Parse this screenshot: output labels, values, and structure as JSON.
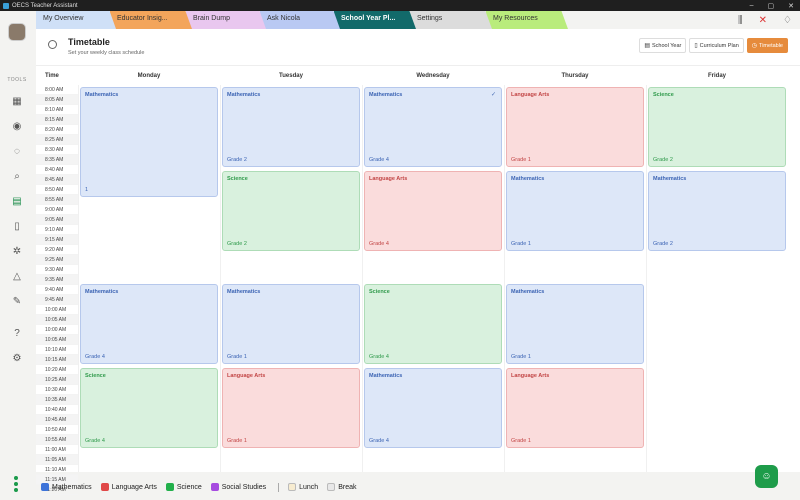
{
  "window": {
    "title": "OECS Teacher Assistant"
  },
  "tabs": [
    {
      "label": "My Overview",
      "color": "#cfe0f7"
    },
    {
      "label": "Educator Insig...",
      "color": "#f3a55b"
    },
    {
      "label": "Brain Dump",
      "color": "#e9c7ef"
    },
    {
      "label": "Ask Nicola",
      "color": "#b9c9f3"
    },
    {
      "label": "School Year Pl...",
      "color": "#126a6a",
      "active": true
    },
    {
      "label": "Settings",
      "color": "#dcdcdc"
    },
    {
      "label": "My Resources",
      "color": "#b9ec7c"
    }
  ],
  "sidebar": {
    "tools_label": "TOOLS"
  },
  "header": {
    "title": "Timetable",
    "subtitle": "Set your weekly class schedule",
    "views": [
      {
        "label": "School Year",
        "icon": "calendar-icon"
      },
      {
        "label": "Curriculum Plan",
        "icon": "book-icon"
      },
      {
        "label": "Timetable",
        "icon": "clock-icon",
        "active": true
      }
    ]
  },
  "grid": {
    "time_header": "Time",
    "days": [
      "Monday",
      "Tuesday",
      "Wednesday",
      "Thursday",
      "Friday"
    ],
    "times": [
      "8:00 AM",
      "8:05 AM",
      "8:10 AM",
      "8:15 AM",
      "8:20 AM",
      "8:25 AM",
      "8:30 AM",
      "8:35 AM",
      "8:40 AM",
      "8:45 AM",
      "8:50 AM",
      "8:55 AM",
      "9:00 AM",
      "9:05 AM",
      "9:10 AM",
      "9:15 AM",
      "9:20 AM",
      "9:25 AM",
      "9:30 AM",
      "9:35 AM",
      "9:40 AM",
      "9:45 AM",
      "10:00 AM",
      "10:05 AM",
      "10:00 AM",
      "10:05 AM",
      "10:10 AM",
      "10:15 AM",
      "10:20 AM",
      "10:25 AM",
      "10:30 AM",
      "10:35 AM",
      "10:40 AM",
      "10:45 AM",
      "10:50 AM",
      "10:55 AM",
      "11:00 AM",
      "11:05 AM",
      "11:10 AM",
      "11:15 AM",
      "11:20 AM"
    ]
  },
  "classes": [
    {
      "day": 0,
      "slot": 0,
      "span": 11,
      "subject": "Mathematics",
      "grade": "1",
      "type": "math"
    },
    {
      "day": 1,
      "slot": 0,
      "span": 8,
      "subject": "Mathematics",
      "grade": "Grade 2",
      "type": "math"
    },
    {
      "day": 2,
      "slot": 0,
      "span": 8,
      "subject": "Mathematics",
      "grade": "Grade 4",
      "type": "math",
      "checked": true
    },
    {
      "day": 3,
      "slot": 0,
      "span": 8,
      "subject": "Language Arts",
      "grade": "Grade 1",
      "type": "lang"
    },
    {
      "day": 4,
      "slot": 0,
      "span": 8,
      "subject": "Science",
      "grade": "Grade 2",
      "type": "sci"
    },
    {
      "day": 1,
      "slot": 8.4,
      "span": 8,
      "subject": "Science",
      "grade": "Grade 2",
      "type": "sci"
    },
    {
      "day": 2,
      "slot": 8.4,
      "span": 8,
      "subject": "Language Arts",
      "grade": "Grade 4",
      "type": "lang"
    },
    {
      "day": 3,
      "slot": 8.4,
      "span": 8,
      "subject": "Mathematics",
      "grade": "Grade 1",
      "type": "math"
    },
    {
      "day": 4,
      "slot": 8.4,
      "span": 8,
      "subject": "Mathematics",
      "grade": "Grade 2",
      "type": "math"
    },
    {
      "day": 0,
      "slot": 19.7,
      "span": 8,
      "subject": "Mathematics",
      "grade": "Grade 4",
      "type": "math"
    },
    {
      "day": 1,
      "slot": 19.7,
      "span": 8,
      "subject": "Mathematics",
      "grade": "Grade 1",
      "type": "math"
    },
    {
      "day": 2,
      "slot": 19.7,
      "span": 8,
      "subject": "Science",
      "grade": "Grade 4",
      "type": "sci"
    },
    {
      "day": 3,
      "slot": 19.7,
      "span": 8,
      "subject": "Mathematics",
      "grade": "Grade 1",
      "type": "math"
    },
    {
      "day": 0,
      "slot": 28.1,
      "span": 8,
      "subject": "Science",
      "grade": "Grade 4",
      "type": "sci"
    },
    {
      "day": 1,
      "slot": 28.1,
      "span": 8,
      "subject": "Language Arts",
      "grade": "Grade 1",
      "type": "lang"
    },
    {
      "day": 2,
      "slot": 28.1,
      "span": 8,
      "subject": "Mathematics",
      "grade": "Grade 4",
      "type": "math"
    },
    {
      "day": 3,
      "slot": 28.1,
      "span": 8,
      "subject": "Language Arts",
      "grade": "Grade 1",
      "type": "lang"
    }
  ],
  "legend": [
    {
      "label": "Mathematics",
      "color": "#3d73d9"
    },
    {
      "label": "Language Arts",
      "color": "#e04848"
    },
    {
      "label": "Science",
      "color": "#22b04b"
    },
    {
      "label": "Social Studies",
      "color": "#a64be0"
    },
    {
      "label": "Lunch",
      "color": "#f7ecd0",
      "divider_before": true
    },
    {
      "label": "Break",
      "color": "#e8e8e8"
    }
  ]
}
